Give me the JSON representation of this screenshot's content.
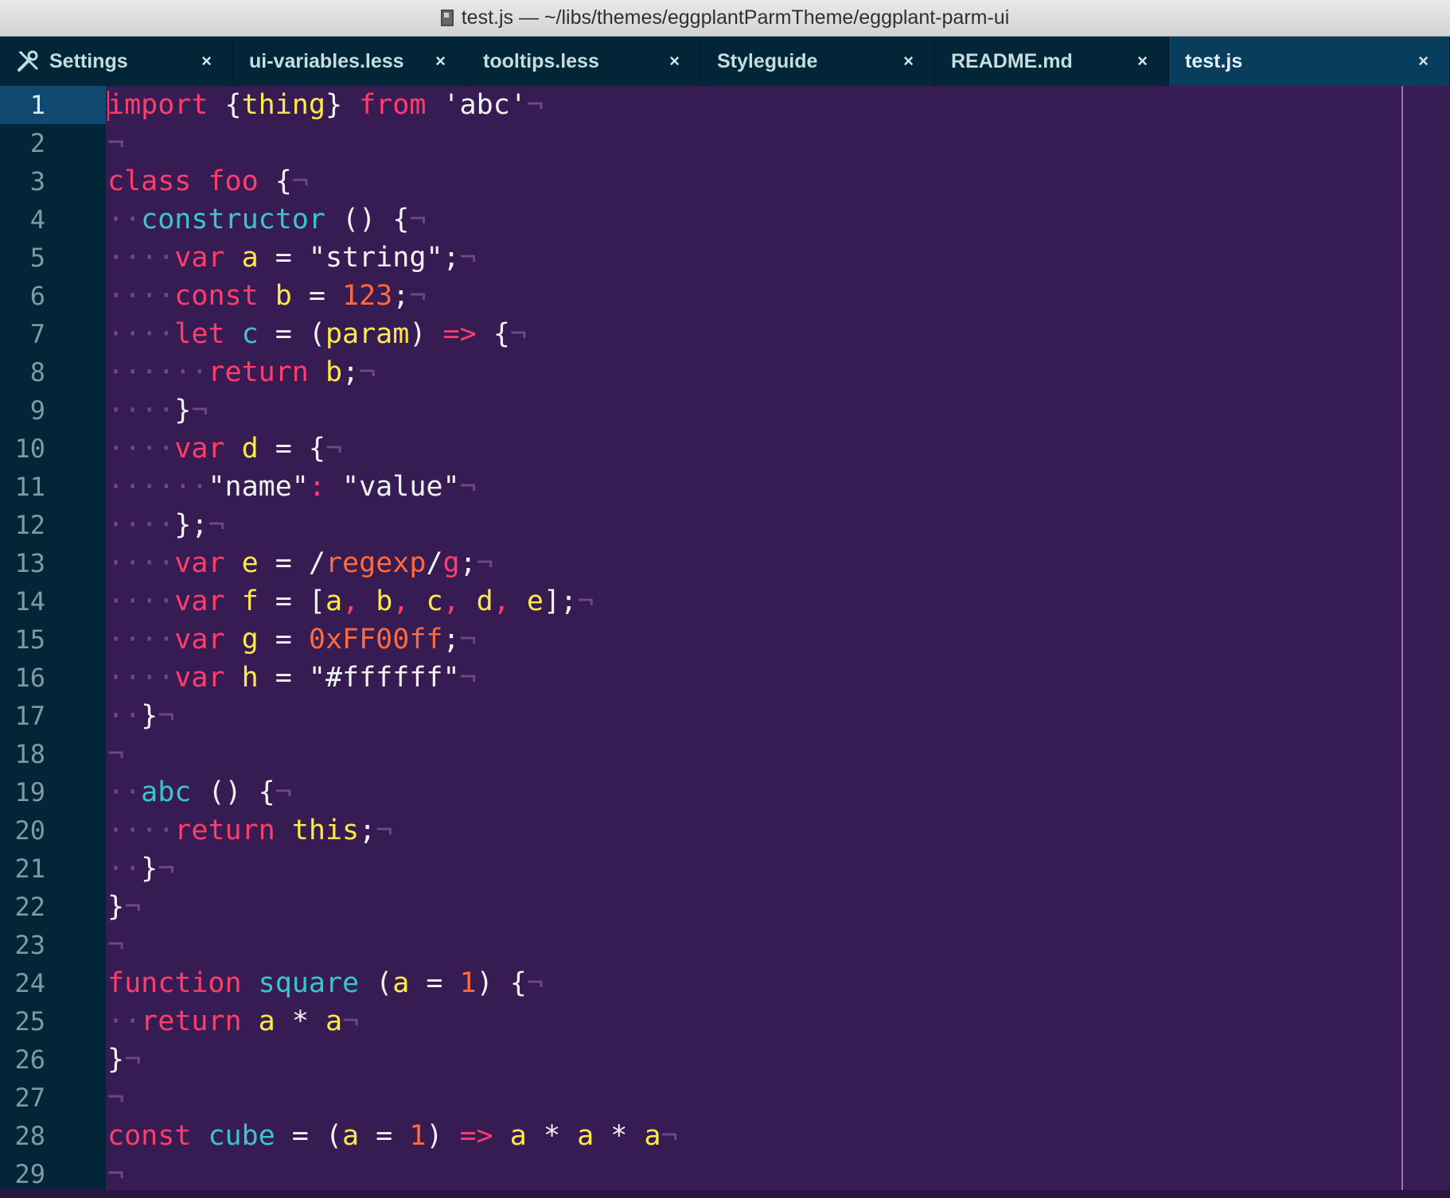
{
  "window": {
    "title": "test.js — ~/libs/themes/eggplantParmTheme/eggplant-parm-ui"
  },
  "tabs": [
    {
      "label": "Settings",
      "icon": "tools-icon",
      "active": false
    },
    {
      "label": "ui-variables.less",
      "active": false
    },
    {
      "label": "tooltips.less",
      "active": false
    },
    {
      "label": "Styleguide",
      "active": false
    },
    {
      "label": "README.md",
      "active": false
    },
    {
      "label": "test.js",
      "active": true
    }
  ],
  "tab_close_glyph": "×",
  "editor": {
    "active_line": 1,
    "eol_glyph": "¬",
    "indent_glyph": "·",
    "colors": {
      "background": "#361c52",
      "gutter": "#032538",
      "keyword": "#ff3d6b",
      "function": "#38c7c9",
      "variable": "#ffe84a",
      "number": "#ff6a3d",
      "string": "#f2f2f2",
      "wrap_guide": "#9a6fc7"
    },
    "lines": [
      {
        "n": 1,
        "indent": 0,
        "tokens": [
          [
            "kw",
            "import"
          ],
          [
            "pun",
            " {"
          ],
          [
            "var",
            "thing"
          ],
          [
            "pun",
            "} "
          ],
          [
            "kw",
            "from"
          ],
          [
            "str",
            " 'abc'"
          ]
        ]
      },
      {
        "n": 2,
        "indent": 0,
        "tokens": []
      },
      {
        "n": 3,
        "indent": 0,
        "tokens": [
          [
            "kw",
            "class"
          ],
          [
            "pun",
            " "
          ],
          [
            "kw",
            "foo"
          ],
          [
            "pun",
            " {"
          ]
        ]
      },
      {
        "n": 4,
        "indent": 1,
        "tokens": [
          [
            "fn",
            "constructor"
          ],
          [
            "pun",
            " () {"
          ]
        ]
      },
      {
        "n": 5,
        "indent": 2,
        "tokens": [
          [
            "kw",
            "var"
          ],
          [
            "pun",
            " "
          ],
          [
            "var",
            "a"
          ],
          [
            "op",
            " = "
          ],
          [
            "str",
            "\"string\""
          ],
          [
            "pun",
            ";"
          ]
        ]
      },
      {
        "n": 6,
        "indent": 2,
        "tokens": [
          [
            "kw",
            "const"
          ],
          [
            "pun",
            " "
          ],
          [
            "var",
            "b"
          ],
          [
            "op",
            " = "
          ],
          [
            "num",
            "123"
          ],
          [
            "pun",
            ";"
          ]
        ]
      },
      {
        "n": 7,
        "indent": 2,
        "tokens": [
          [
            "kw",
            "let"
          ],
          [
            "pun",
            " "
          ],
          [
            "fn",
            "c"
          ],
          [
            "op",
            " = "
          ],
          [
            "pun",
            "("
          ],
          [
            "var",
            "param"
          ],
          [
            "pun",
            ") "
          ],
          [
            "kw",
            "=>"
          ],
          [
            "pun",
            " {"
          ]
        ]
      },
      {
        "n": 8,
        "indent": 3,
        "tokens": [
          [
            "kw",
            "return"
          ],
          [
            "pun",
            " "
          ],
          [
            "var",
            "b"
          ],
          [
            "pun",
            ";"
          ]
        ]
      },
      {
        "n": 9,
        "indent": 2,
        "tokens": [
          [
            "pun",
            "}"
          ]
        ]
      },
      {
        "n": 10,
        "indent": 2,
        "tokens": [
          [
            "kw",
            "var"
          ],
          [
            "pun",
            " "
          ],
          [
            "var",
            "d"
          ],
          [
            "op",
            " = "
          ],
          [
            "pun",
            "{"
          ]
        ]
      },
      {
        "n": 11,
        "indent": 3,
        "tokens": [
          [
            "str",
            "\"name\""
          ],
          [
            "sep",
            ":"
          ],
          [
            "pun",
            " "
          ],
          [
            "str",
            "\"value\""
          ]
        ]
      },
      {
        "n": 12,
        "indent": 2,
        "tokens": [
          [
            "pun",
            "};"
          ]
        ]
      },
      {
        "n": 13,
        "indent": 2,
        "tokens": [
          [
            "kw",
            "var"
          ],
          [
            "pun",
            " "
          ],
          [
            "var",
            "e"
          ],
          [
            "op",
            " = "
          ],
          [
            "pun",
            "/"
          ],
          [
            "rx",
            "regexp"
          ],
          [
            "pun",
            "/"
          ],
          [
            "kw",
            "g"
          ],
          [
            "pun",
            ";"
          ]
        ]
      },
      {
        "n": 14,
        "indent": 2,
        "tokens": [
          [
            "kw",
            "var"
          ],
          [
            "pun",
            " "
          ],
          [
            "var",
            "f"
          ],
          [
            "op",
            " = "
          ],
          [
            "pun",
            "["
          ],
          [
            "var",
            "a"
          ],
          [
            "sep",
            ","
          ],
          [
            "pun",
            " "
          ],
          [
            "var",
            "b"
          ],
          [
            "sep",
            ","
          ],
          [
            "pun",
            " "
          ],
          [
            "var",
            "c"
          ],
          [
            "sep",
            ","
          ],
          [
            "pun",
            " "
          ],
          [
            "var",
            "d"
          ],
          [
            "sep",
            ","
          ],
          [
            "pun",
            " "
          ],
          [
            "var",
            "e"
          ],
          [
            "pun",
            "];"
          ]
        ]
      },
      {
        "n": 15,
        "indent": 2,
        "tokens": [
          [
            "kw",
            "var"
          ],
          [
            "pun",
            " "
          ],
          [
            "var",
            "g"
          ],
          [
            "op",
            " = "
          ],
          [
            "num",
            "0xFF00ff"
          ],
          [
            "pun",
            ";"
          ]
        ]
      },
      {
        "n": 16,
        "indent": 2,
        "tokens": [
          [
            "kw",
            "var"
          ],
          [
            "pun",
            " "
          ],
          [
            "var",
            "h"
          ],
          [
            "op",
            " = "
          ],
          [
            "str",
            "\"#ffffff\""
          ]
        ]
      },
      {
        "n": 17,
        "indent": 1,
        "tokens": [
          [
            "pun",
            "}"
          ]
        ]
      },
      {
        "n": 18,
        "indent": 0,
        "tokens": []
      },
      {
        "n": 19,
        "indent": 1,
        "tokens": [
          [
            "fn",
            "abc"
          ],
          [
            "pun",
            " () {"
          ]
        ]
      },
      {
        "n": 20,
        "indent": 2,
        "tokens": [
          [
            "kw",
            "return"
          ],
          [
            "pun",
            " "
          ],
          [
            "var",
            "this"
          ],
          [
            "pun",
            ";"
          ]
        ]
      },
      {
        "n": 21,
        "indent": 1,
        "tokens": [
          [
            "pun",
            "}"
          ]
        ]
      },
      {
        "n": 22,
        "indent": 0,
        "tokens": [
          [
            "pun",
            "}"
          ]
        ]
      },
      {
        "n": 23,
        "indent": 0,
        "tokens": []
      },
      {
        "n": 24,
        "indent": 0,
        "tokens": [
          [
            "kw",
            "function"
          ],
          [
            "pun",
            " "
          ],
          [
            "fn",
            "square"
          ],
          [
            "pun",
            " ("
          ],
          [
            "var",
            "a"
          ],
          [
            "op",
            " = "
          ],
          [
            "num",
            "1"
          ],
          [
            "pun",
            ") {"
          ]
        ]
      },
      {
        "n": 25,
        "indent": 1,
        "tokens": [
          [
            "kw",
            "return"
          ],
          [
            "pun",
            " "
          ],
          [
            "var",
            "a"
          ],
          [
            "op",
            " * "
          ],
          [
            "var",
            "a"
          ]
        ]
      },
      {
        "n": 26,
        "indent": 0,
        "tokens": [
          [
            "pun",
            "}"
          ]
        ]
      },
      {
        "n": 27,
        "indent": 0,
        "tokens": []
      },
      {
        "n": 28,
        "indent": 0,
        "tokens": [
          [
            "kw",
            "const"
          ],
          [
            "pun",
            " "
          ],
          [
            "fn",
            "cube"
          ],
          [
            "op",
            " = "
          ],
          [
            "pun",
            "("
          ],
          [
            "var",
            "a"
          ],
          [
            "op",
            " = "
          ],
          [
            "num",
            "1"
          ],
          [
            "pun",
            ") "
          ],
          [
            "kw",
            "=>"
          ],
          [
            "pun",
            " "
          ],
          [
            "var",
            "a"
          ],
          [
            "op",
            " * "
          ],
          [
            "var",
            "a"
          ],
          [
            "op",
            " * "
          ],
          [
            "var",
            "a"
          ]
        ]
      },
      {
        "n": 29,
        "indent": 0,
        "tokens": []
      }
    ]
  }
}
